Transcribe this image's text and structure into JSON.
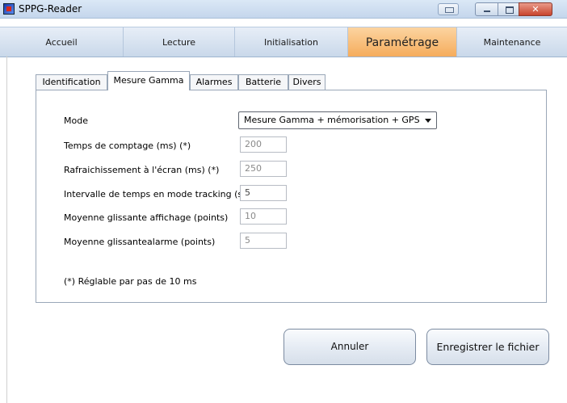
{
  "window": {
    "title": "SPPG-Reader"
  },
  "main_tabs": [
    {
      "label": "Accueil"
    },
    {
      "label": "Lecture"
    },
    {
      "label": "Initialisation"
    },
    {
      "label": "Paramétrage"
    },
    {
      "label": "Maintenance"
    }
  ],
  "active_main_tab": "Paramétrage",
  "sub_tabs": [
    {
      "label": "Identification"
    },
    {
      "label": "Mesure Gamma"
    },
    {
      "label": "Alarmes"
    },
    {
      "label": "Batterie"
    },
    {
      "label": "Divers"
    }
  ],
  "active_sub_tab": "Mesure Gamma",
  "form": {
    "mode": {
      "label": "Mode",
      "value": "Mesure Gamma + mémorisation + GPS"
    },
    "temps_comptage": {
      "label": "Temps de comptage (ms)  (*)",
      "value": "200"
    },
    "rafraichissement": {
      "label": "Rafraichissement à l'écran (ms)  (*)",
      "value": "250"
    },
    "intervalle_tracking": {
      "label": "Intervalle de temps en mode tracking (s)",
      "value": "5"
    },
    "moyenne_affichage": {
      "label": "Moyenne glissante affichage (points)",
      "value": "10"
    },
    "moyenne_alarme": {
      "label": "Moyenne glissantealarme (points)",
      "value": "5"
    },
    "note": "(*)  Réglable par pas de 10 ms"
  },
  "actions": {
    "cancel_label": "Annuler",
    "save_label": "Enregistrer le fichier"
  },
  "colors": {
    "active_tab": "#f5ac5c",
    "title_bar": "#c4d6ec",
    "close_button": "#c8442c"
  }
}
